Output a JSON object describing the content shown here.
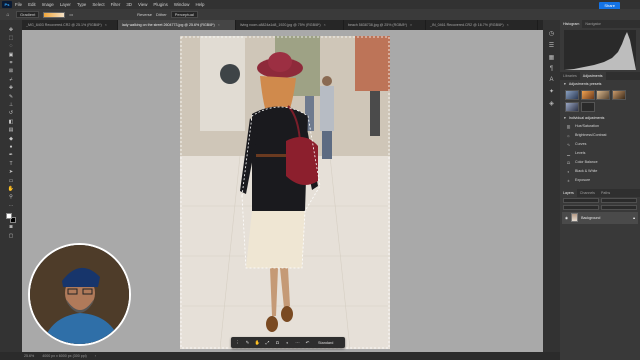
{
  "menubar": {
    "app": "Ps",
    "items": [
      "File",
      "Edit",
      "Image",
      "Layer",
      "Type",
      "Select",
      "Filter",
      "3D",
      "View",
      "Plugins",
      "Window",
      "Help"
    ],
    "share_label": "Share"
  },
  "options": {
    "tool_name": "Gradient",
    "items": [
      "Reverse",
      "Dither",
      "Perceptual"
    ]
  },
  "tabs": [
    {
      "label": "_MG_8403 Recovered.CR2 @ 25.1% (RGB/8*)",
      "active": false
    },
    {
      "label": "lady walking on the street 2604773.jpg @ 25.6% (RGB/8*)",
      "active": true
    },
    {
      "label": "living room-c8824a1d8_1920.jpg @ 75% (RGB/8*)",
      "active": false
    },
    {
      "label": "beach 5838738.jpg @ 25% (RGB/8*)",
      "active": false
    },
    {
      "label": "_IN_0461 Recovered.CR2 @ 16.7% (RGB/8*)",
      "active": false
    }
  ],
  "statusbar": {
    "zoom": "25.6%",
    "doc": "4000 px x 6000 px (300 ppi)"
  },
  "context_bar": {
    "label": "Standard"
  },
  "panels": {
    "top_tabs": [
      "Histogram",
      "Navigator"
    ],
    "adj_tabs": [
      "Libraries",
      "Adjustments"
    ],
    "presets_title": "Adjustments presets",
    "individual_title": "Individual adjustments",
    "adjustments": [
      "Hue/Saturation",
      "Brightness/Contrast",
      "Curves",
      "Levels",
      "Color Balance",
      "Black & White",
      "Exposure"
    ],
    "layers_tabs": [
      "Layers",
      "Channels",
      "Paths"
    ],
    "layer_name": "Background"
  },
  "colors": {
    "accent": "#1473e6",
    "panel": "#393939",
    "canvas_bg": "#a9a9a9"
  }
}
